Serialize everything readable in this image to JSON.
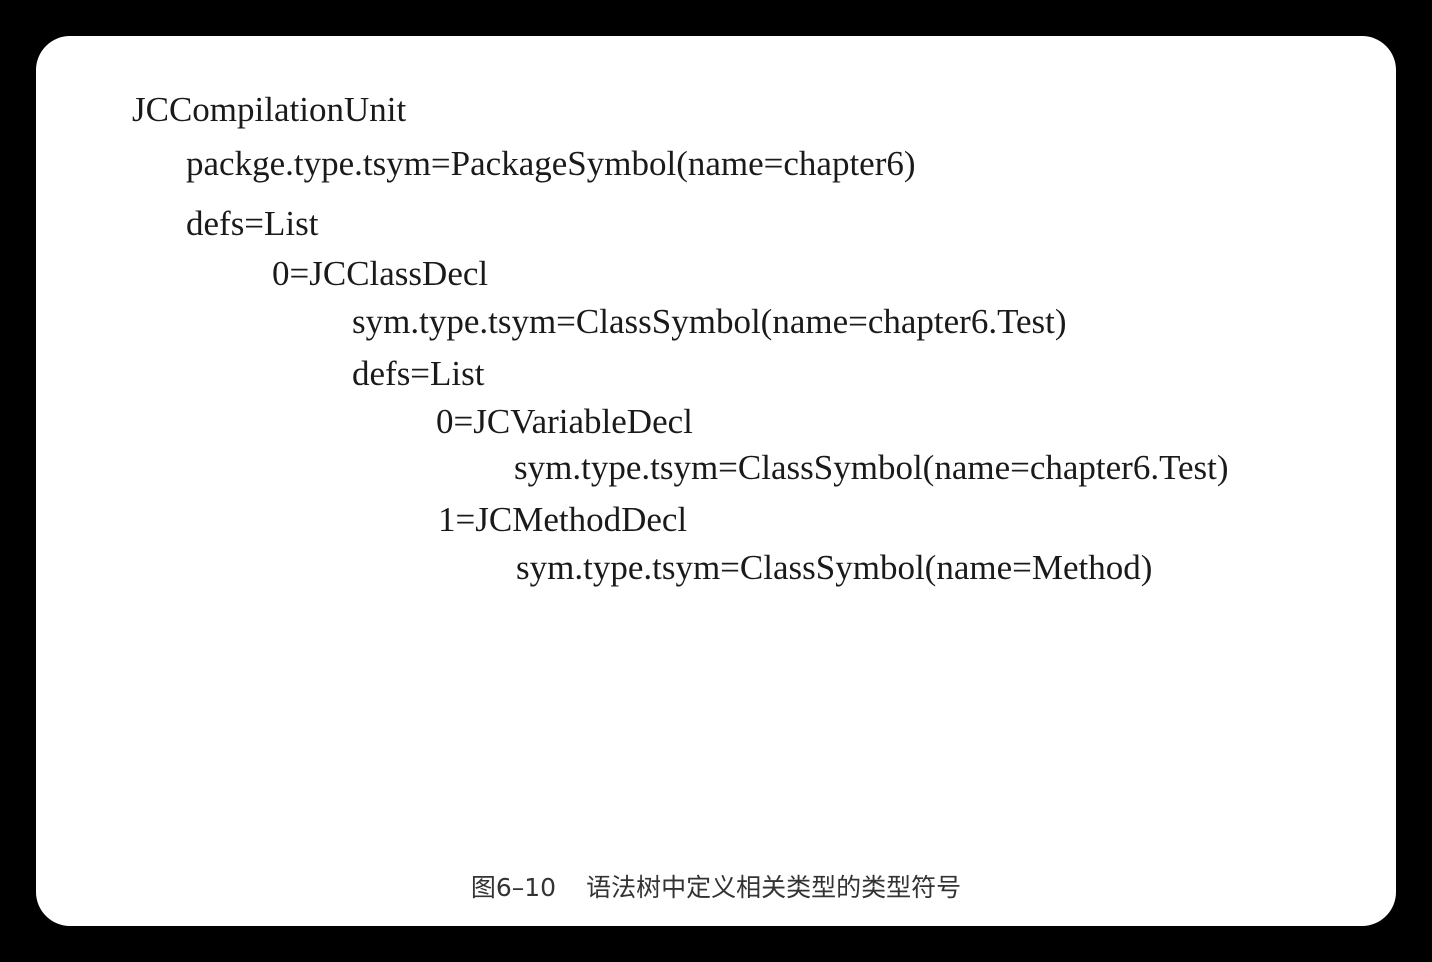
{
  "tree": [
    {
      "text": "JCCompilationUnit"
    },
    {
      "text": "packge.type.tsym=PackageSymbol(name=chapter6)"
    },
    {
      "text": "defs=List"
    },
    {
      "text": "0=JCClassDecl"
    },
    {
      "text": "sym.type.tsym=ClassSymbol(name=chapter6.Test)"
    },
    {
      "text": "defs=List"
    },
    {
      "text": "0=JCVariableDecl"
    },
    {
      "text": "sym.type.tsym=ClassSymbol(name=chapter6.Test)"
    },
    {
      "text": "1=JCMethodDecl"
    },
    {
      "text": "sym.type.tsym=ClassSymbol(name=Method)"
    }
  ],
  "caption": {
    "number": "图6–10",
    "title": "语法树中定义相关类型的类型符号"
  }
}
